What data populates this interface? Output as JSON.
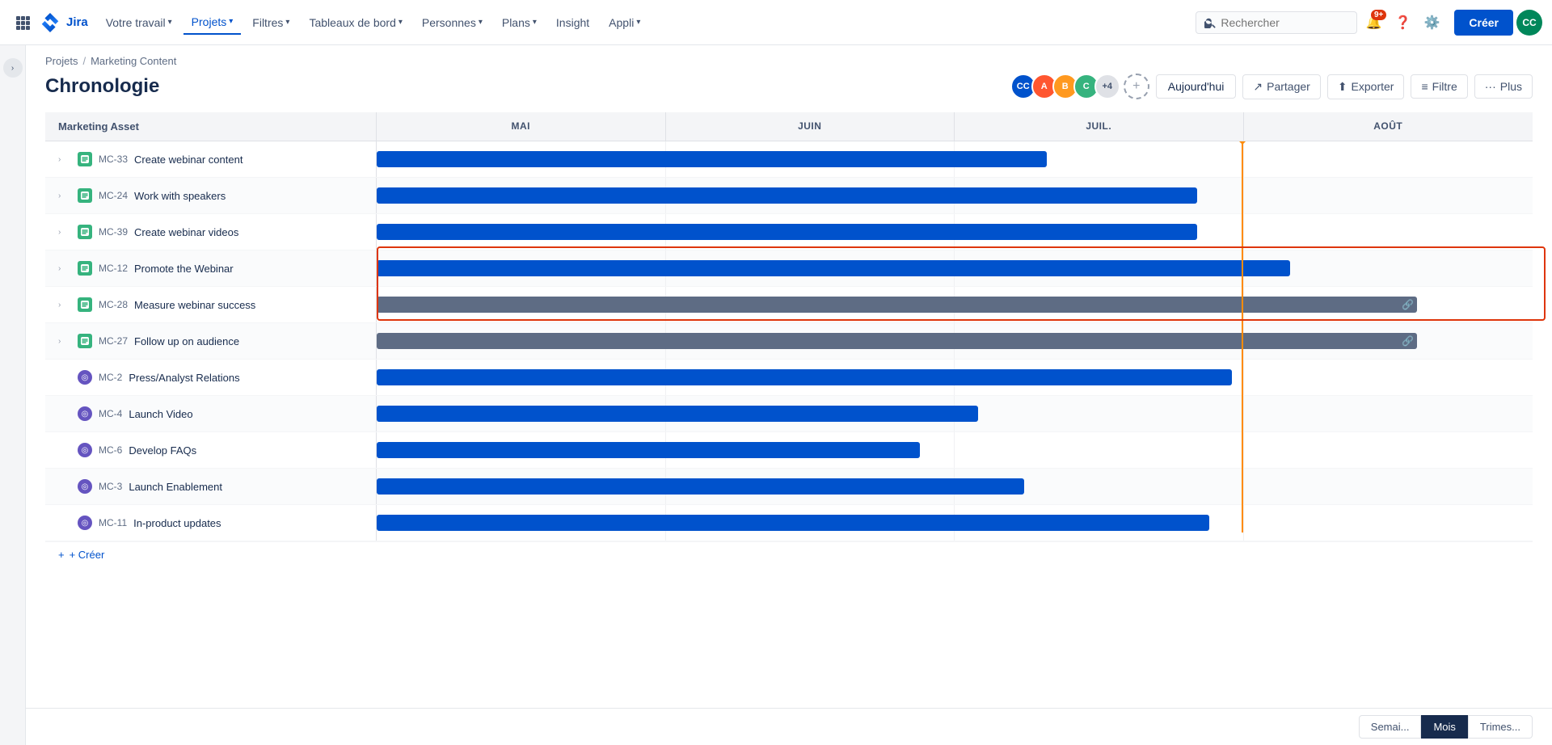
{
  "app": {
    "logo_text": "Jira",
    "nav_items": [
      {
        "label": "Votre travail",
        "has_dropdown": true
      },
      {
        "label": "Projets",
        "has_dropdown": true,
        "active": true
      },
      {
        "label": "Filtres",
        "has_dropdown": true
      },
      {
        "label": "Tableaux de bord",
        "has_dropdown": true
      },
      {
        "label": "Personnes",
        "has_dropdown": true
      },
      {
        "label": "Plans",
        "has_dropdown": true
      },
      {
        "label": "Insight",
        "has_dropdown": false
      },
      {
        "label": "Appli",
        "has_dropdown": true
      }
    ],
    "create_label": "Créer",
    "search_placeholder": "Rechercher",
    "notifications_badge": "9+"
  },
  "breadcrumb": {
    "items": [
      "Projets",
      "Marketing Content"
    ]
  },
  "page": {
    "title": "Chronologie",
    "header_btns": {
      "today": "Aujourd'hui",
      "share": "Partager",
      "export": "Exporter",
      "filter": "Filtre",
      "more": "Plus"
    }
  },
  "avatars": [
    {
      "initials": "CC",
      "bg": "#0052cc",
      "color": "#fff"
    },
    {
      "initials": "A",
      "bg": "#ff5630",
      "color": "#fff"
    },
    {
      "initials": "B",
      "bg": "#ff991f",
      "color": "#fff"
    },
    {
      "initials": "C",
      "bg": "#36b37e",
      "color": "#fff"
    }
  ],
  "avatar_count": "+4",
  "timeline": {
    "header": {
      "label_col": "Marketing Asset",
      "months": [
        "MAI",
        "JUIN",
        "JUIL.",
        "AOÛT"
      ]
    },
    "today_position_pct": 74,
    "rows": [
      {
        "id": "MC-33",
        "name": "Create webinar content",
        "type": "story",
        "expandable": true,
        "bar": {
          "start_pct": 0,
          "width_pct": 58,
          "color": "blue"
        }
      },
      {
        "id": "MC-24",
        "name": "Work with speakers",
        "type": "story",
        "expandable": true,
        "bar": {
          "start_pct": 0,
          "width_pct": 71,
          "color": "blue"
        }
      },
      {
        "id": "MC-39",
        "name": "Create webinar videos",
        "type": "story",
        "expandable": true,
        "bar": {
          "start_pct": 0,
          "width_pct": 71,
          "color": "blue"
        }
      },
      {
        "id": "MC-12",
        "name": "Promote the Webinar",
        "type": "story",
        "expandable": true,
        "bar": {
          "start_pct": 0,
          "width_pct": 79,
          "color": "blue"
        },
        "highlight": true
      },
      {
        "id": "MC-28",
        "name": "Measure webinar success",
        "type": "story",
        "expandable": true,
        "bar": {
          "start_pct": 0,
          "width_pct": 90,
          "color": "gray"
        },
        "highlight": true,
        "has_link": true
      },
      {
        "id": "MC-27",
        "name": "Follow up on audience",
        "type": "story",
        "expandable": true,
        "bar": {
          "start_pct": 0,
          "width_pct": 90,
          "color": "gray"
        },
        "has_link": true
      },
      {
        "id": "MC-2",
        "name": "Press/Analyst Relations",
        "type": "epic",
        "expandable": false,
        "bar": {
          "start_pct": 0,
          "width_pct": 74,
          "color": "blue"
        }
      },
      {
        "id": "MC-4",
        "name": "Launch Video",
        "type": "epic",
        "expandable": false,
        "bar": {
          "start_pct": 0,
          "width_pct": 52,
          "color": "blue"
        }
      },
      {
        "id": "MC-6",
        "name": "Develop FAQs",
        "type": "epic",
        "expandable": false,
        "bar": {
          "start_pct": 0,
          "width_pct": 47,
          "color": "blue"
        }
      },
      {
        "id": "MC-3",
        "name": "Launch Enablement",
        "type": "epic",
        "expandable": false,
        "bar": {
          "start_pct": 0,
          "width_pct": 56,
          "color": "blue"
        }
      },
      {
        "id": "MC-11",
        "name": "In-product updates",
        "type": "epic",
        "expandable": false,
        "bar": {
          "start_pct": 0,
          "width_pct": 72,
          "color": "blue"
        }
      }
    ],
    "add_label": "+ Créer"
  },
  "view_buttons": [
    {
      "label": "Semai...",
      "active": false
    },
    {
      "label": "Mois",
      "active": true
    },
    {
      "label": "Trimes...",
      "active": false
    }
  ]
}
